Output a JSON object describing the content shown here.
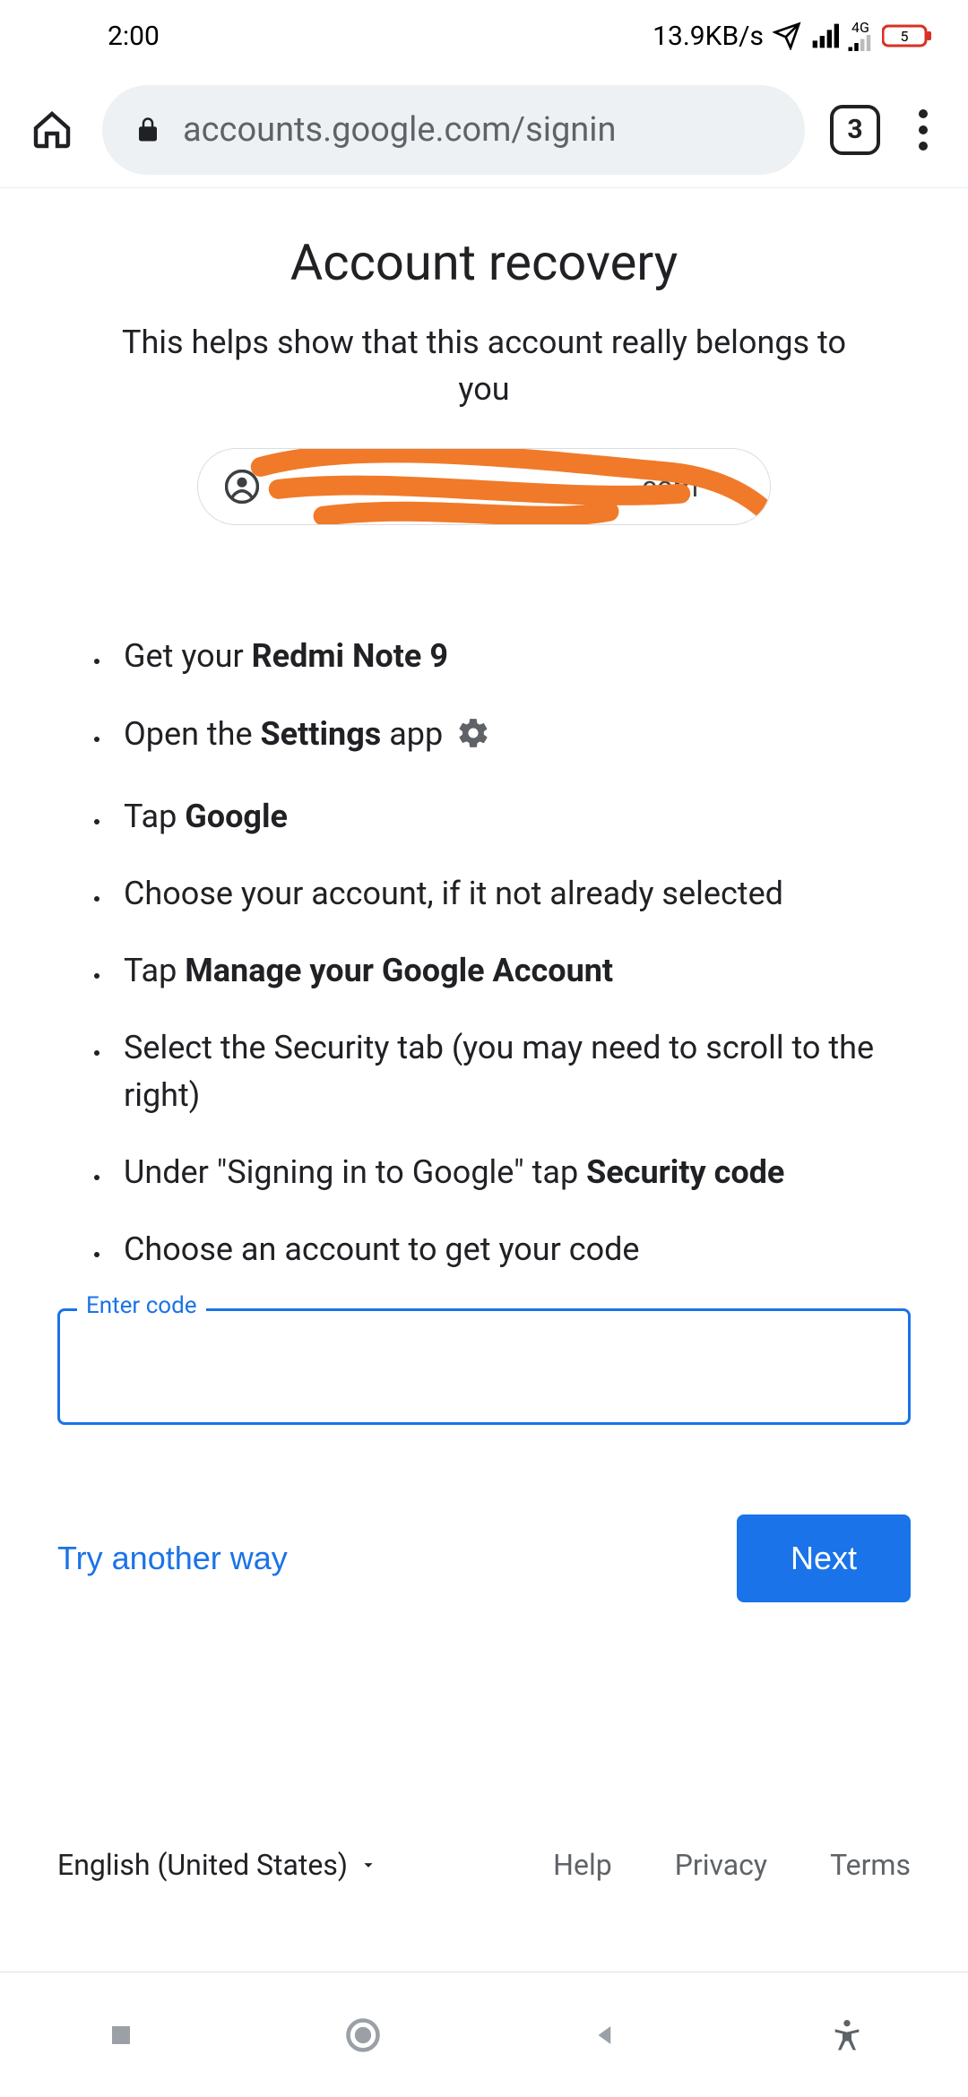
{
  "status": {
    "time": "2:00",
    "net_speed": "13.9KB/s",
    "net_label": "4G",
    "battery_text": "5"
  },
  "browser": {
    "url_display": "accounts.google.com/signin",
    "tab_count": "3"
  },
  "page": {
    "title": "Account recovery",
    "subtitle": "This helps show that this account really belongs to you",
    "email_visible_fragment": ".com"
  },
  "steps": [
    {
      "pre": "Get your ",
      "bold": "Redmi Note 9",
      "post": "",
      "gear": false
    },
    {
      "pre": "Open the ",
      "bold": "Settings",
      "post": " app",
      "gear": true
    },
    {
      "pre": "Tap ",
      "bold": "Google",
      "post": "",
      "gear": false
    },
    {
      "pre": "Choose your account, if it not already selected",
      "bold": "",
      "post": "",
      "gear": false
    },
    {
      "pre": "Tap ",
      "bold": "Manage your Google Account",
      "post": "",
      "gear": false
    },
    {
      "pre": "Select the Security tab (you may need to scroll to the right)",
      "bold": "",
      "post": "",
      "gear": false
    },
    {
      "pre": "Under \"Signing in to Google\" tap ",
      "bold": "Security code",
      "post": "",
      "gear": false
    },
    {
      "pre": "Choose an account to get your code",
      "bold": "",
      "post": "",
      "gear": false
    }
  ],
  "input": {
    "label": "Enter code",
    "value": ""
  },
  "actions": {
    "try_another": "Try another way",
    "next": "Next"
  },
  "footer": {
    "language": "English (United States)",
    "help": "Help",
    "privacy": "Privacy",
    "terms": "Terms"
  }
}
